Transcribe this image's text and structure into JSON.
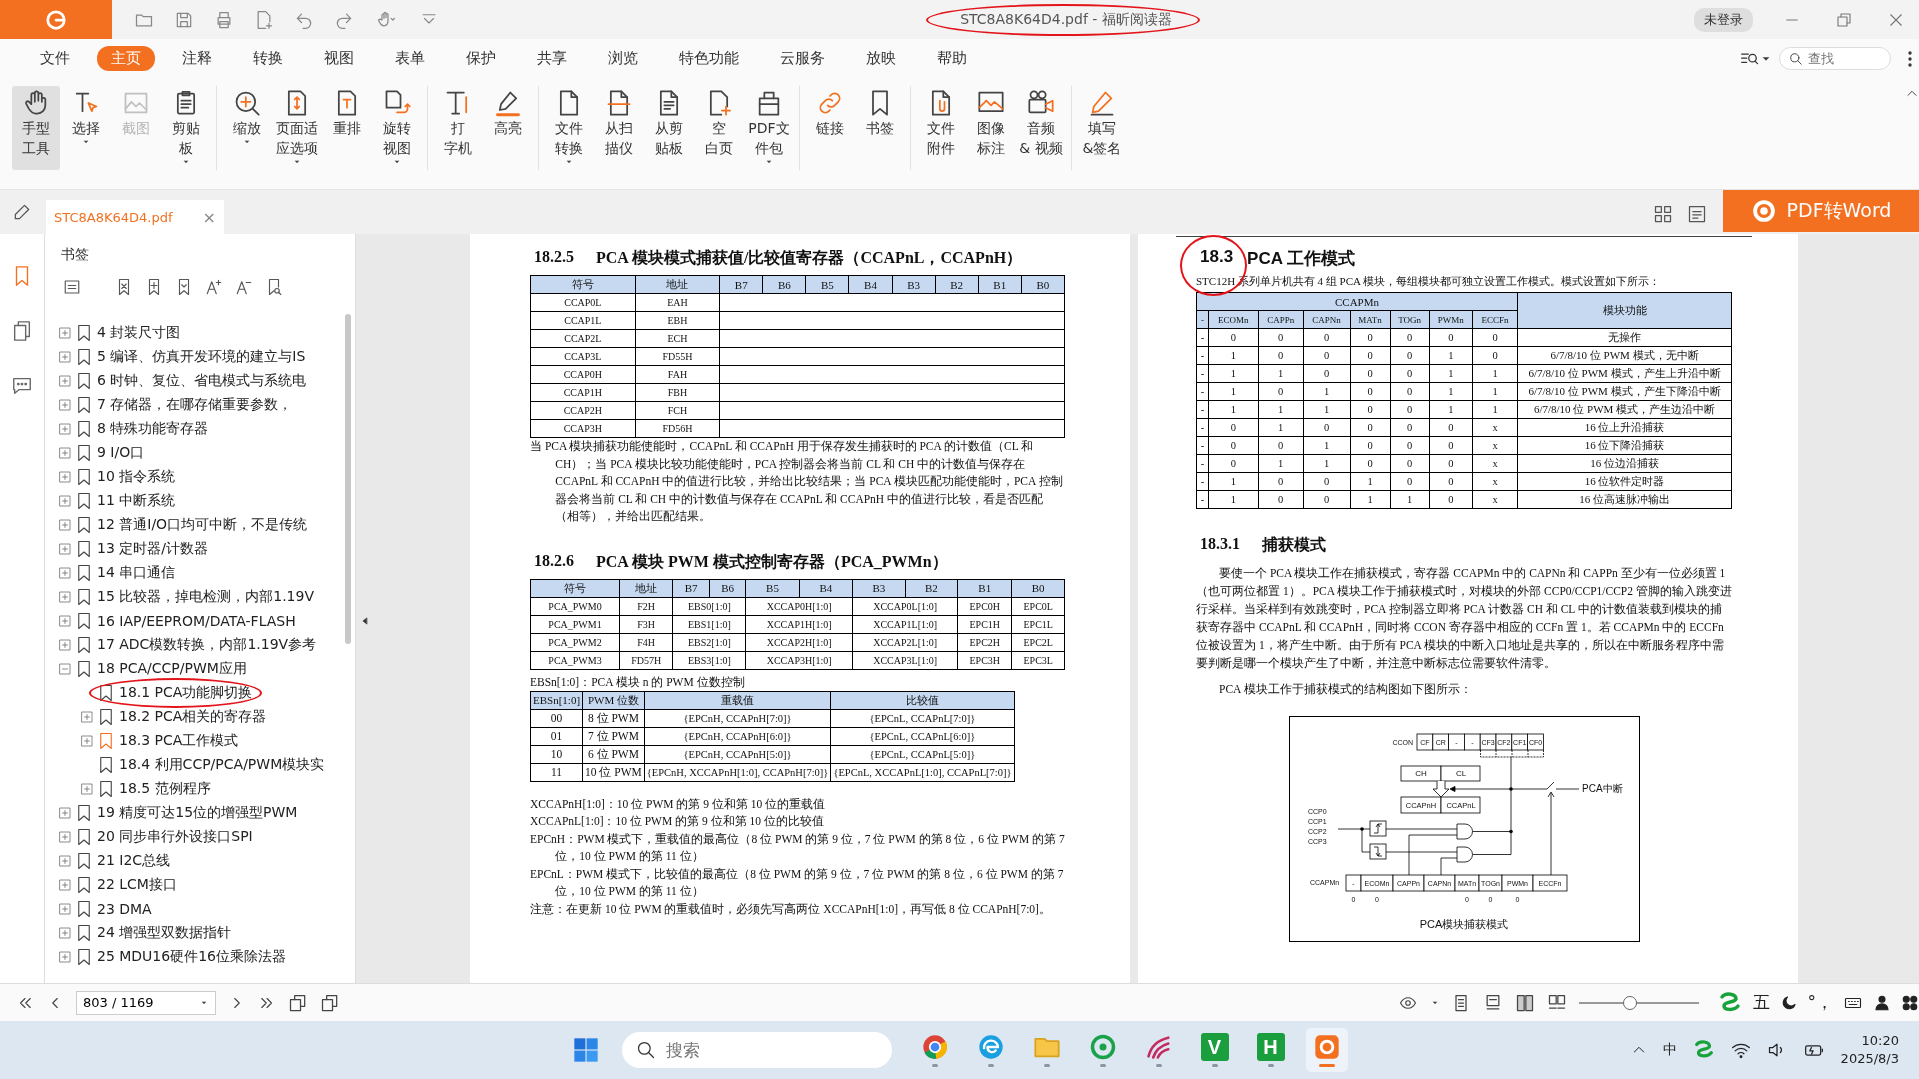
{
  "window": {
    "title": "STC8A8K64D4.pdf - 福昕阅读器",
    "circled": true,
    "login": "未登录"
  },
  "menu": {
    "items": [
      {
        "label": "文件",
        "selected": false
      },
      {
        "label": "主页",
        "selected": true
      },
      {
        "label": "注释",
        "selected": false
      },
      {
        "label": "转换",
        "selected": false
      },
      {
        "label": "视图",
        "selected": false
      },
      {
        "label": "表单",
        "selected": false
      },
      {
        "label": "保护",
        "selected": false
      },
      {
        "label": "共享",
        "selected": false
      },
      {
        "label": "浏览",
        "selected": false
      },
      {
        "label": "特色功能",
        "selected": false
      },
      {
        "label": "云服务",
        "selected": false
      },
      {
        "label": "放映",
        "selected": false
      },
      {
        "label": "帮助",
        "selected": false
      }
    ],
    "search": {
      "placeholder": "查找"
    }
  },
  "ribbon": {
    "groups": [
      [
        {
          "kind": "hand",
          "lines": [
            "手型",
            "工具"
          ],
          "selected": true,
          "disabled": false,
          "dropdown": false
        },
        {
          "kind": "select",
          "lines": [
            "选择"
          ],
          "selected": false,
          "disabled": false,
          "dropdown": true
        },
        {
          "kind": "screenshot",
          "lines": [
            "截图"
          ],
          "selected": false,
          "disabled": true,
          "dropdown": false
        },
        {
          "kind": "clipboard",
          "lines": [
            "剪贴",
            "板"
          ],
          "selected": false,
          "disabled": false,
          "dropdown": true
        }
      ],
      [
        {
          "kind": "zoom",
          "lines": [
            "缩放"
          ],
          "selected": false,
          "disabled": false,
          "dropdown": true
        },
        {
          "kind": "fit",
          "lines": [
            "页面适",
            "应选项"
          ],
          "selected": false,
          "disabled": false,
          "dropdown": true
        },
        {
          "kind": "reflow",
          "lines": [
            "重排"
          ],
          "selected": false,
          "disabled": false,
          "dropdown": false
        },
        {
          "kind": "rotate",
          "lines": [
            "旋转",
            "视图"
          ],
          "selected": false,
          "disabled": false,
          "dropdown": true
        }
      ],
      [
        {
          "kind": "typewriter",
          "lines": [
            "打",
            "字机"
          ],
          "selected": false,
          "disabled": false,
          "dropdown": false
        },
        {
          "kind": "highlight",
          "lines": [
            "高亮"
          ],
          "selected": false,
          "disabled": false,
          "dropdown": false
        }
      ],
      [
        {
          "kind": "convert",
          "lines": [
            "文件",
            "转换"
          ],
          "selected": false,
          "disabled": false,
          "dropdown": true
        },
        {
          "kind": "scan",
          "lines": [
            "从扫",
            "描仪"
          ],
          "selected": false,
          "disabled": false,
          "dropdown": false
        },
        {
          "kind": "paste",
          "lines": [
            "从剪",
            "贴板"
          ],
          "selected": false,
          "disabled": false,
          "dropdown": false
        },
        {
          "kind": "blank",
          "lines": [
            "空",
            "白页"
          ],
          "selected": false,
          "disabled": false,
          "dropdown": false
        },
        {
          "kind": "package",
          "lines": [
            "PDF文",
            "件包"
          ],
          "selected": false,
          "disabled": false,
          "dropdown": true
        }
      ],
      [
        {
          "kind": "link",
          "lines": [
            "链接"
          ],
          "selected": false,
          "disabled": false,
          "dropdown": false
        },
        {
          "kind": "bookmark",
          "lines": [
            "书签"
          ],
          "selected": false,
          "disabled": false,
          "dropdown": false
        }
      ],
      [
        {
          "kind": "attach",
          "lines": [
            "文件",
            "附件"
          ],
          "selected": false,
          "disabled": false,
          "dropdown": false
        },
        {
          "kind": "image",
          "lines": [
            "图像",
            "标注"
          ],
          "selected": false,
          "disabled": false,
          "dropdown": false
        },
        {
          "kind": "media",
          "lines": [
            "音频",
            "& 视频"
          ],
          "selected": false,
          "disabled": false,
          "dropdown": false
        }
      ],
      [
        {
          "kind": "sign",
          "lines": [
            "填写",
            "&签名"
          ],
          "selected": false,
          "disabled": false,
          "dropdown": false
        }
      ]
    ]
  },
  "tab": {
    "label": "STC8A8K64D4.pdf",
    "close": "×"
  },
  "convert_button": "PDF转Word",
  "bookmarks": {
    "title": "书签",
    "items": [
      {
        "label": "4 封装尺寸图",
        "expandable": true,
        "expanded": false,
        "marked": false,
        "circled": false
      },
      {
        "label": "5 编译、仿真开发环境的建立与IS",
        "expandable": true,
        "expanded": false,
        "marked": false,
        "circled": false
      },
      {
        "label": "6 时钟、复位、省电模式与系统电",
        "expandable": true,
        "expanded": false,
        "marked": false,
        "circled": false
      },
      {
        "label": "7 存储器，在哪存储重要参数，",
        "expandable": true,
        "expanded": false,
        "marked": false,
        "circled": false
      },
      {
        "label": "8 特殊功能寄存器",
        "expandable": true,
        "expanded": false,
        "marked": false,
        "circled": false
      },
      {
        "label": "9 I/O口",
        "expandable": true,
        "expanded": false,
        "marked": false,
        "circled": false
      },
      {
        "label": "10 指令系统",
        "expandable": true,
        "expanded": false,
        "marked": false,
        "circled": false
      },
      {
        "label": "11 中断系统",
        "expandable": true,
        "expanded": false,
        "marked": false,
        "circled": false
      },
      {
        "label": "12 普通I/O口均可中断，不是传统",
        "expandable": true,
        "expanded": false,
        "marked": false,
        "circled": false
      },
      {
        "label": "13 定时器/计数器",
        "expandable": true,
        "expanded": false,
        "marked": false,
        "circled": false
      },
      {
        "label": "14 串口通信",
        "expandable": true,
        "expanded": false,
        "marked": false,
        "circled": false
      },
      {
        "label": "15 比较器，掉电检测，内部1.19V",
        "expandable": true,
        "expanded": false,
        "marked": false,
        "circled": false
      },
      {
        "label": "16 IAP/EEPROM/DATA-FLASH",
        "expandable": true,
        "expanded": false,
        "marked": false,
        "circled": false
      },
      {
        "label": "17 ADC模数转换，内部1.19V参考",
        "expandable": true,
        "expanded": false,
        "marked": false,
        "circled": false
      },
      {
        "label": "18 PCA/CCP/PWM应用",
        "expandable": true,
        "expanded": true,
        "marked": false,
        "circled": false,
        "children": [
          {
            "label": "18.1 PCA功能脚切换",
            "expandable": false,
            "marked": false,
            "circled": true
          },
          {
            "label": "18.2 PCA相关的寄存器",
            "expandable": true,
            "expanded": false,
            "marked": false,
            "circled": false
          },
          {
            "label": "18.3 PCA工作模式",
            "expandable": true,
            "expanded": false,
            "marked": true,
            "circled": false
          },
          {
            "label": "18.4 利用CCP/PCA/PWM模块实",
            "expandable": false,
            "marked": false,
            "circled": false
          },
          {
            "label": "18.5 范例程序",
            "expandable": true,
            "expanded": false,
            "marked": false,
            "circled": false
          }
        ]
      },
      {
        "label": "19 精度可达15位的增强型PWM",
        "expandable": true,
        "expanded": false,
        "marked": false,
        "circled": false
      },
      {
        "label": "20 同步串行外设接口SPI",
        "expandable": true,
        "expanded": false,
        "marked": false,
        "circled": false
      },
      {
        "label": "21 I2C总线",
        "expandable": true,
        "expanded": false,
        "marked": false,
        "circled": false
      },
      {
        "label": "22 LCM接口",
        "expandable": true,
        "expanded": false,
        "marked": false,
        "circled": false
      },
      {
        "label": "23 DMA",
        "expandable": true,
        "expanded": false,
        "marked": false,
        "circled": false
      },
      {
        "label": "24 增强型双数据指针",
        "expandable": true,
        "expanded": false,
        "marked": false,
        "circled": false
      },
      {
        "label": "25 MDU16硬件16位乘除法器",
        "expandable": true,
        "expanded": false,
        "marked": false,
        "circled": false
      }
    ]
  },
  "left_page": {
    "blocks": [
      {
        "kind": "heading",
        "number": "18.2.5",
        "text": "PCA 模块模式捕获值/比较值寄存器（CCAPnL，CCAPnH）"
      },
      {
        "kind": "reg_table",
        "columns": [
          "符号",
          "地址",
          "B7",
          "B6",
          "B5",
          "B4",
          "B3",
          "B2",
          "B1",
          "B0"
        ],
        "rows": [
          [
            "CCAP0L",
            "EAH"
          ],
          [
            "CCAP1L",
            "EBH"
          ],
          [
            "CCAP2L",
            "ECH"
          ],
          [
            "CCAP3L",
            "FD55H"
          ],
          [
            "CCAP0H",
            "FAH"
          ],
          [
            "CCAP1H",
            "FBH"
          ],
          [
            "CCAP2H",
            "FCH"
          ],
          [
            "CCAP3H",
            "FD56H"
          ]
        ]
      },
      {
        "kind": "hanging",
        "text": "当 PCA 模块捕获功能使能时，CCAPnL 和 CCAPnH 用于保存发生捕获时的 PCA 的计数值（CL 和 CH）；当 PCA 模块比较功能使能时，PCA 控制器会将当前 CL 和 CH 中的计数值与保存在 CCAPnL 和 CCAPnH 中的值进行比较，并给出比较结果；当 PCA 模块匹配功能使能时，PCA 控制器会将当前 CL 和 CH 中的计数值与保存在 CCAPnL 和 CCAPnH 中的值进行比较，看是否匹配（相等），并给出匹配结果。"
      },
      {
        "kind": "heading",
        "number": "18.2.6",
        "text": "PCA 模块 PWM 模式控制寄存器（PCA_PWMn）"
      },
      {
        "kind": "reg_table",
        "columns": [
          "符号",
          "地址",
          "B7",
          "B6",
          "B5",
          "B4",
          "B3",
          "B2",
          "B1",
          "B0"
        ],
        "rows": [
          [
            "PCA_PWM0",
            "F2H",
            {
              "text": "EBS0[1:0]",
              "colspan": 2
            },
            {
              "text": "XCCAP0H[1:0]",
              "colspan": 2
            },
            {
              "text": "XCCAP0L[1:0]",
              "colspan": 2
            },
            "EPC0H",
            "EPC0L"
          ],
          [
            "PCA_PWM1",
            "F3H",
            {
              "text": "EBS1[1:0]",
              "colspan": 2
            },
            {
              "text": "XCCAP1H[1:0]",
              "colspan": 2
            },
            {
              "text": "XCCAP1L[1:0]",
              "colspan": 2
            },
            "EPC1H",
            "EPC1L"
          ],
          [
            "PCA_PWM2",
            "F4H",
            {
              "text": "EBS2[1:0]",
              "colspan": 2
            },
            {
              "text": "XCCAP2H[1:0]",
              "colspan": 2
            },
            {
              "text": "XCCAP2L[1:0]",
              "colspan": 2
            },
            "EPC2H",
            "EPC2L"
          ],
          [
            "PCA_PWM3",
            "FD57H",
            {
              "text": "EBS3[1:0]",
              "colspan": 2
            },
            {
              "text": "XCCAP3H[1:0]",
              "colspan": 2
            },
            {
              "text": "XCCAP3L[1:0]",
              "colspan": 2
            },
            "EPC3H",
            "EPC3L"
          ]
        ]
      },
      {
        "kind": "caption",
        "text": "EBSn[1:0]：PCA 模块 n 的 PWM 位数控制"
      },
      {
        "kind": "value_table",
        "columns": [
          "EBSn[1:0]",
          "PWM 位数",
          "重载值",
          "比较值"
        ],
        "rows": [
          [
            "00",
            "8 位 PWM",
            "{EPCnH, CCAPnH[7:0]}",
            "{EPCnL, CCAPnL[7:0]}"
          ],
          [
            "01",
            "7 位 PWM",
            "{EPCnH, CCAPnH[6:0]}",
            "{EPCnL, CCAPnL[6:0]}"
          ],
          [
            "10",
            "6 位 PWM",
            "{EPCnH, CCAPnH[5:0]}",
            "{EPCnL, CCAPnL[5:0]}"
          ],
          [
            "11",
            "10 位 PWM",
            "{EPCnH, XCCAPnH[1:0], CCAPnH[7:0]}",
            "{EPCnL, XCCAPnL[1:0], CCAPnL[7:0]}"
          ]
        ]
      },
      {
        "kind": "hanging",
        "text": "XCCAPnH[1:0]：10 位 PWM 的第 9 位和第 10 位的重载值"
      },
      {
        "kind": "hanging",
        "text": "XCCAPnL[1:0]：10 位 PWM 的第 9 位和第 10 位的比较值"
      },
      {
        "kind": "hanging",
        "text": "EPCnH：PWM 模式下，重载值的最高位（8 位 PWM 的第 9 位，7 位 PWM 的第 8 位，6 位 PWM 的第 7 位，10 位 PWM 的第 11 位）"
      },
      {
        "kind": "hanging",
        "text": "EPCnL：PWM 模式下，比较值的最高位（8 位 PWM 的第 9 位，7 位 PWM 的第 8 位，6 位 PWM 的第 7 位，10 位 PWM 的第 11 位）"
      },
      {
        "kind": "hanging",
        "text": "注意：在更新 10 位 PWM 的重载值时，必须先写高两位 XCCAPnH[1:0]，再写低 8 位 CCAPnH[7:0]。"
      }
    ]
  },
  "right_page": {
    "blocks": [
      {
        "kind": "title",
        "number": "18.3",
        "text": "PCA 工作模式",
        "circled": true
      },
      {
        "kind": "plain",
        "text": "STC12H 系列单片机共有 4 组 PCA 模块，每组模块都可独立设置工作模式。模式设置如下所示："
      },
      {
        "kind": "mode_table",
        "group": "CCAPMn",
        "function": "模块功能",
        "columns": [
          "-",
          "ECOMn",
          "CAPPn",
          "CAPNn",
          "MATn",
          "TOGn",
          "PWMn",
          "ECCFn"
        ],
        "rows": [
          {
            "bits": [
              "-",
              "0",
              "0",
              "0",
              "0",
              "0",
              "0",
              "0"
            ],
            "function": "无操作"
          },
          {
            "bits": [
              "-",
              "1",
              "0",
              "0",
              "0",
              "0",
              "1",
              "0"
            ],
            "function": "6/7/8/10 位 PWM 模式，无中断"
          },
          {
            "bits": [
              "-",
              "1",
              "1",
              "0",
              "0",
              "0",
              "1",
              "1"
            ],
            "function": "6/7/8/10 位 PWM 模式，产生上升沿中断"
          },
          {
            "bits": [
              "-",
              "1",
              "0",
              "1",
              "0",
              "0",
              "1",
              "1"
            ],
            "function": "6/7/8/10 位 PWM 模式，产生下降沿中断"
          },
          {
            "bits": [
              "-",
              "1",
              "1",
              "1",
              "0",
              "0",
              "1",
              "1"
            ],
            "function": "6/7/8/10 位 PWM 模式，产生边沿中断"
          },
          {
            "bits": [
              "-",
              "0",
              "1",
              "0",
              "0",
              "0",
              "0",
              "x"
            ],
            "function": "16 位上升沿捕获"
          },
          {
            "bits": [
              "-",
              "0",
              "0",
              "1",
              "0",
              "0",
              "0",
              "x"
            ],
            "function": "16 位下降沿捕获"
          },
          {
            "bits": [
              "-",
              "0",
              "1",
              "1",
              "0",
              "0",
              "0",
              "x"
            ],
            "function": "16 位边沿捕获"
          },
          {
            "bits": [
              "-",
              "1",
              "0",
              "0",
              "1",
              "0",
              "0",
              "x"
            ],
            "function": "16 位软件定时器"
          },
          {
            "bits": [
              "-",
              "1",
              "0",
              "0",
              "1",
              "1",
              "0",
              "x"
            ],
            "function": "16 位高速脉冲输出"
          }
        ]
      },
      {
        "kind": "heading",
        "number": "18.3.1",
        "text": "捕获模式"
      },
      {
        "kind": "paragraph",
        "text": "要使一个 PCA 模块工作在捕获模式，寄存器 CCAPMn 中的 CAPNn 和 CAPPn 至少有一位必须置 1（也可两位都置 1）。PCA 模块工作于捕获模式时，对模块的外部 CCP0/CCP1/CCP2 管脚的输入跳变进行采样。当采样到有效跳变时，PCA 控制器立即将 PCA 计数器 CH 和 CL 中的计数值装载到模块的捕获寄存器中 CCAPnL 和 CCAPnH，同时将 CCON 寄存器中相应的 CCFn 置 1。若 CCAPMn 中的 ECCFn 位被设置为 1，将产生中断。由于所有 PCA 模块的中断入口地址是共享的，所以在中断服务程序中需要判断是哪一个模块产生了中断，并注意中断标志位需要软件清零。"
      },
      {
        "kind": "paragraph",
        "text": "PCA 模块工作于捕获模式的结构图如下图所示："
      },
      {
        "kind": "diagram",
        "ccon_label": "CCON",
        "ccon_bits": [
          "CF",
          "CR",
          "-",
          "-",
          "CF3",
          "CF2",
          "CF1",
          "CF0"
        ],
        "counter": [
          "CH",
          "CL"
        ],
        "capture": [
          "CCAPnH",
          "CCAPnL"
        ],
        "interrupt": "PCA中断",
        "inputs": [
          "CCP0",
          "CCP1",
          "CCP2",
          "CCP3"
        ],
        "ccapm_label": "CCAPMn",
        "ccapm_bits": [
          {
            "bit": "-",
            "value": "0"
          },
          {
            "bit": "ECOMn",
            "value": "0"
          },
          {
            "bit": "CAPPn"
          },
          {
            "bit": "CAPNn"
          },
          {
            "bit": "MATn",
            "value": "0"
          },
          {
            "bit": "TOGn",
            "value": "0"
          },
          {
            "bit": "PWMn",
            "value": "0"
          },
          {
            "bit": "ECCFn"
          }
        ],
        "caption": "PCA模块捕获模式"
      }
    ]
  },
  "navigation": {
    "page": "803 / 1169",
    "zoom": {
      "level": 0.43
    }
  },
  "ime_bar": {
    "mode": "五",
    "punctuation": "°，"
  },
  "taskbar": {
    "search": {
      "placeholder": "搜索"
    },
    "apps": [
      {
        "kind": "browser",
        "active": false
      },
      {
        "kind": "edge",
        "active": false
      },
      {
        "kind": "folder",
        "active": false
      },
      {
        "kind": "chat",
        "active": false
      },
      {
        "kind": "wave",
        "active": false
      },
      {
        "kind": "green",
        "glyph": "V",
        "active": false
      },
      {
        "kind": "green",
        "glyph": "H",
        "active": false
      },
      {
        "kind": "reader",
        "active": true
      }
    ],
    "tray": {
      "ime": "中",
      "time": "10:20",
      "date": "2025/8/3"
    }
  }
}
